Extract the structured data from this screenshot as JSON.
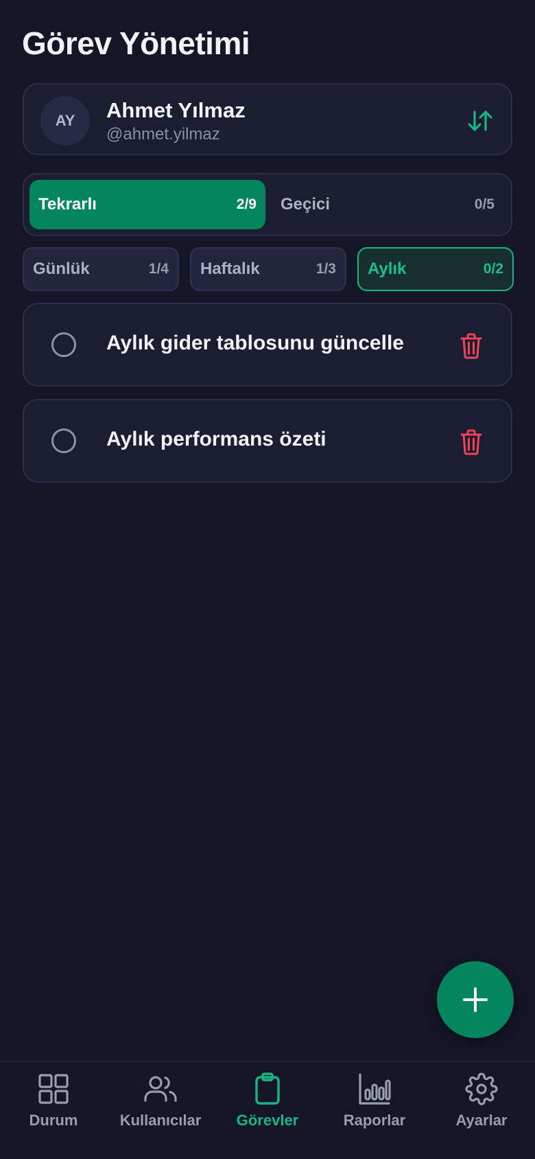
{
  "header": {
    "title": "Görev Yönetimi"
  },
  "user": {
    "initials": "AY",
    "name": "Ahmet Yılmaz",
    "handle": "@ahmet.yilmaz",
    "switch_icon": "swap-vertical-icon"
  },
  "task_types": [
    {
      "label": "Tekrarlı",
      "count": "2/9",
      "active": true
    },
    {
      "label": "Geçici",
      "count": "0/5",
      "active": false
    }
  ],
  "periods": [
    {
      "label": "Günlük",
      "count": "1/4",
      "selected": false
    },
    {
      "label": "Haftalık",
      "count": "1/3",
      "selected": false
    },
    {
      "label": "Aylık",
      "count": "0/2",
      "selected": true
    }
  ],
  "tasks": [
    {
      "title": "Aylık gider tablosunu güncelle",
      "done": false
    },
    {
      "title": "Aylık performans özeti",
      "done": false
    }
  ],
  "fab": {
    "icon": "plus-icon"
  },
  "nav": [
    {
      "label": "Durum",
      "icon": "grid-icon",
      "active": false
    },
    {
      "label": "Kullanıcılar",
      "icon": "users-icon",
      "active": false
    },
    {
      "label": "Görevler",
      "icon": "clipboard-icon",
      "active": true
    },
    {
      "label": "Raporlar",
      "icon": "bar-chart-icon",
      "active": false
    },
    {
      "label": "Ayarlar",
      "icon": "settings-icon",
      "active": false
    }
  ],
  "colors": {
    "background": "#141627",
    "card": "#1b1d31",
    "accent": "#03855e",
    "accent_text": "#19c08d",
    "danger": "#f0445a"
  }
}
